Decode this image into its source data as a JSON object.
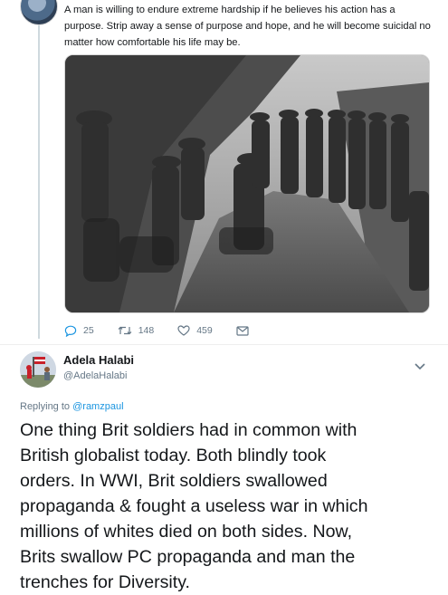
{
  "original_tweet": {
    "text_lines": [
      "A man is willing to endure extreme hardship if he believes his action has a",
      "purpose. Strip away a sense of purpose and hope, and he will become suicidal no",
      "matter how comfortable his life may be."
    ],
    "stats": {
      "replies": "25",
      "retweets": "148",
      "likes": "459"
    }
  },
  "reply": {
    "author_name": "Adela Halabi",
    "author_handle": "@AdelaHalabi",
    "replying_prefix": "Replying to",
    "replying_to": "@ramzpaul",
    "text_lines": [
      "One thing Brit soldiers had in common with",
      "British globalist today. Both blindly took",
      "orders. In WWI, Brit soldiers swallowed",
      "propaganda & fought a useless war in which",
      "millions of whites died on both sides. Now,",
      "Brits swallow PC propaganda and man the",
      "trenches for Diversity."
    ]
  },
  "colors": {
    "link": "#1b95e0",
    "muted": "#657786",
    "text": "#14171a",
    "thread_line": "#cfd9de"
  }
}
